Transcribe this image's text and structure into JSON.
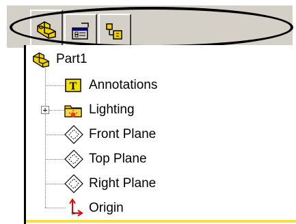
{
  "tabs": [
    {
      "name": "FeatureManager design tree",
      "icon": "part-icon",
      "active": true
    },
    {
      "name": "PropertyManager",
      "icon": "property-icon",
      "active": false
    },
    {
      "name": "ConfigurationManager",
      "icon": "configuration-icon",
      "active": false
    }
  ],
  "tree": {
    "root": {
      "label": "Part1",
      "icon": "part-icon"
    },
    "items": [
      {
        "label": "Annotations",
        "icon": "annotations-icon",
        "expandable": false
      },
      {
        "label": "Lighting",
        "icon": "lighting-folder-icon",
        "expandable": true,
        "expander": "+"
      },
      {
        "label": "Front Plane",
        "icon": "plane-icon",
        "expandable": false
      },
      {
        "label": "Top Plane",
        "icon": "plane-icon",
        "expandable": false
      },
      {
        "label": "Right Plane",
        "icon": "plane-icon",
        "expandable": false
      },
      {
        "label": "Origin",
        "icon": "origin-icon",
        "expandable": false
      }
    ]
  },
  "colors": {
    "part_yellow": "#f2d000",
    "panel_gray": "#d4d0c8",
    "bottom_line": "#f5e042",
    "origin_red": "#e00000"
  }
}
